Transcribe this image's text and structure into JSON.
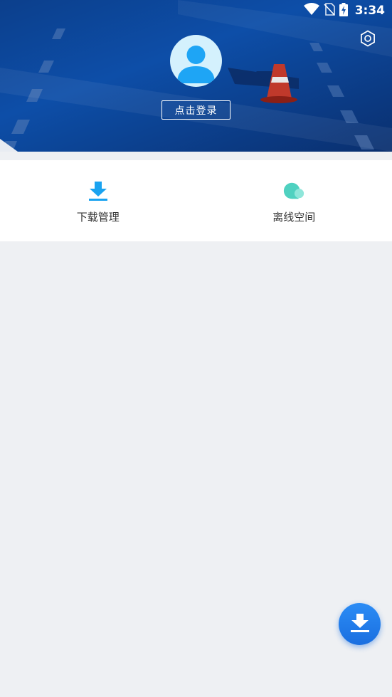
{
  "status_bar": {
    "time": "3:34",
    "icons": [
      "wifi-icon",
      "no-sim-icon",
      "battery-charging-icon"
    ]
  },
  "header": {
    "settings_icon": "gear-icon",
    "avatar_icon": "user-avatar-icon",
    "login_label": "点击登录"
  },
  "quick_actions": [
    {
      "label": "下载管理",
      "icon": "download-icon",
      "color": "#1aa3f0"
    },
    {
      "label": "离线空间",
      "icon": "cloud-icon",
      "color": "#4fd1c0"
    }
  ],
  "fab": {
    "icon": "download-icon",
    "color": "#1a73e8"
  },
  "colors": {
    "header_bg": "#0d4ea8",
    "page_bg": "#eef0f3",
    "avatar_bg": "#d4f1fd",
    "avatar_fg": "#1ea5f5"
  }
}
